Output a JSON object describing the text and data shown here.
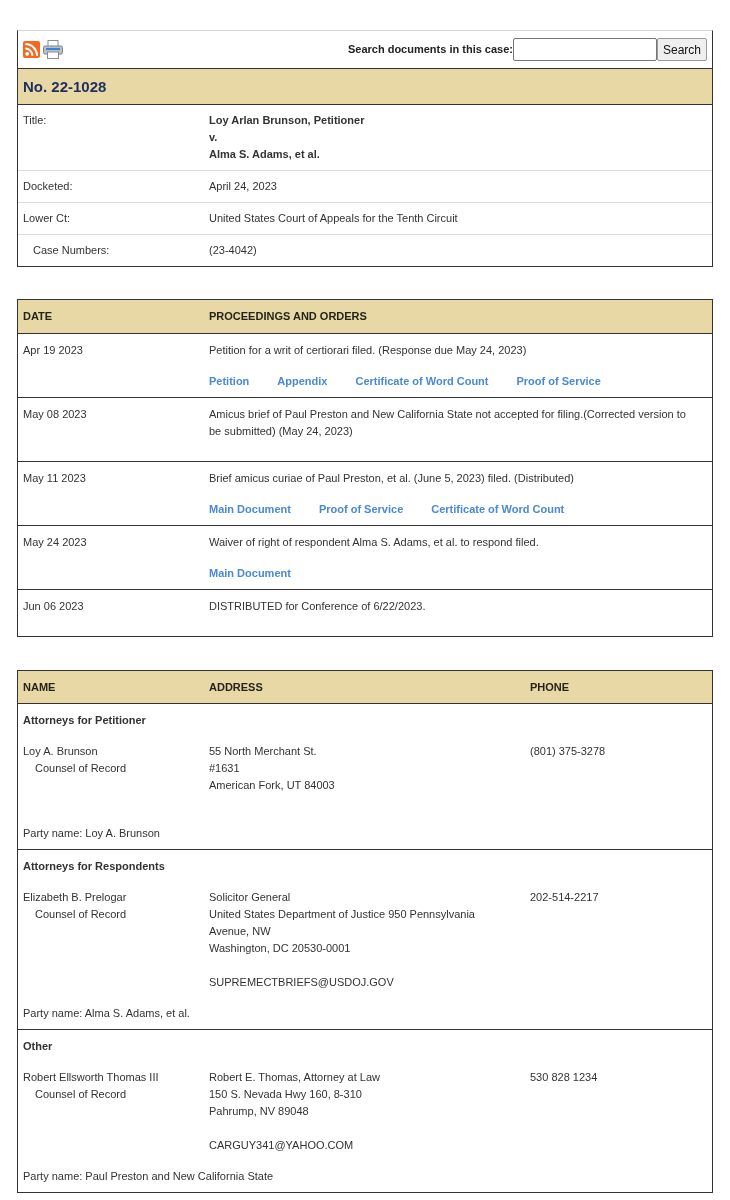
{
  "toolbar": {
    "search_label": "Search documents in this case:",
    "search_button": "Search"
  },
  "case": {
    "number": "No. 22-1028",
    "fields": [
      {
        "kind": "title",
        "label": "Title:",
        "lines": [
          "Loy Arlan Brunson, Petitioner",
          "v.",
          "Alma S. Adams, et al."
        ]
      },
      {
        "kind": "field",
        "label": "Docketed:",
        "value": "April 24, 2023"
      },
      {
        "kind": "field",
        "label": "Lower Ct:",
        "value": "United States Court of Appeals for the Tenth Circuit"
      },
      {
        "kind": "subfield",
        "label": "Case Numbers:",
        "value": "(23-4042)"
      }
    ]
  },
  "proceedings": {
    "columns": [
      "DATE",
      "PROCEEDINGS AND ORDERS"
    ],
    "rows": [
      {
        "date": "Apr 19 2023",
        "text": "Petition for a writ of certiorari filed. (Response due May 24, 2023)",
        "links": [
          "Petition",
          "Appendix",
          "Certificate of Word Count",
          "Proof of Service"
        ]
      },
      {
        "date": "May 08 2023",
        "text": "Amicus brief of Paul Preston and New California State not accepted for filing.(Corrected version to be submitted) (May 24, 2023)"
      },
      {
        "date": "May 11 2023",
        "text": "Brief amicus curiae of Paul Preston, et al. (June 5, 2023) filed. (Distributed)",
        "links": [
          "Main Document",
          "Proof of Service",
          "Certificate of Word Count"
        ]
      },
      {
        "date": "May 24 2023",
        "text": "Waiver of right of respondent Alma S. Adams, et al. to respond filed.",
        "links": [
          "Main Document"
        ]
      },
      {
        "date": "Jun 06 2023",
        "text": "DISTRIBUTED for Conference of 6/22/2023."
      }
    ]
  },
  "parties": {
    "columns": [
      "NAME",
      "ADDRESS",
      "PHONE"
    ],
    "groups": [
      {
        "heading": "Attorneys for Petitioner",
        "attorneys": [
          {
            "name": "Loy A. Brunson",
            "role": "Counsel of Record",
            "address": [
              "55 North Merchant St.",
              "#1631",
              "American Fork, UT 84003"
            ],
            "phone": "(801) 375-3278"
          }
        ],
        "party": "Party name: Loy A. Brunson"
      },
      {
        "heading": "Attorneys for Respondents",
        "attorneys": [
          {
            "name": "Elizabeth B. Prelogar",
            "role": "Counsel of Record",
            "address": [
              "Solicitor General",
              "United States Department of Justice 950 Pennsylvania Avenue, NW",
              "Washington, DC 20530-0001"
            ],
            "email": "SUPREMECTBRIEFS@USDOJ.GOV",
            "phone": "202-514-2217"
          }
        ],
        "party": "Party name: Alma S. Adams, et al."
      },
      {
        "heading": "Other",
        "attorneys": [
          {
            "name": "Robert Ellsworth Thomas III",
            "role": "Counsel of Record",
            "address": [
              "Robert E. Thomas, Attorney at Law",
              "150 S. Nevada Hwy 160, 8-310",
              "Pahrump, NV 89048"
            ],
            "email": "CARGUY341@YAHOO.COM",
            "phone": "530 828 1234"
          }
        ],
        "party": "Party name: Paul Preston and New California State"
      }
    ]
  }
}
